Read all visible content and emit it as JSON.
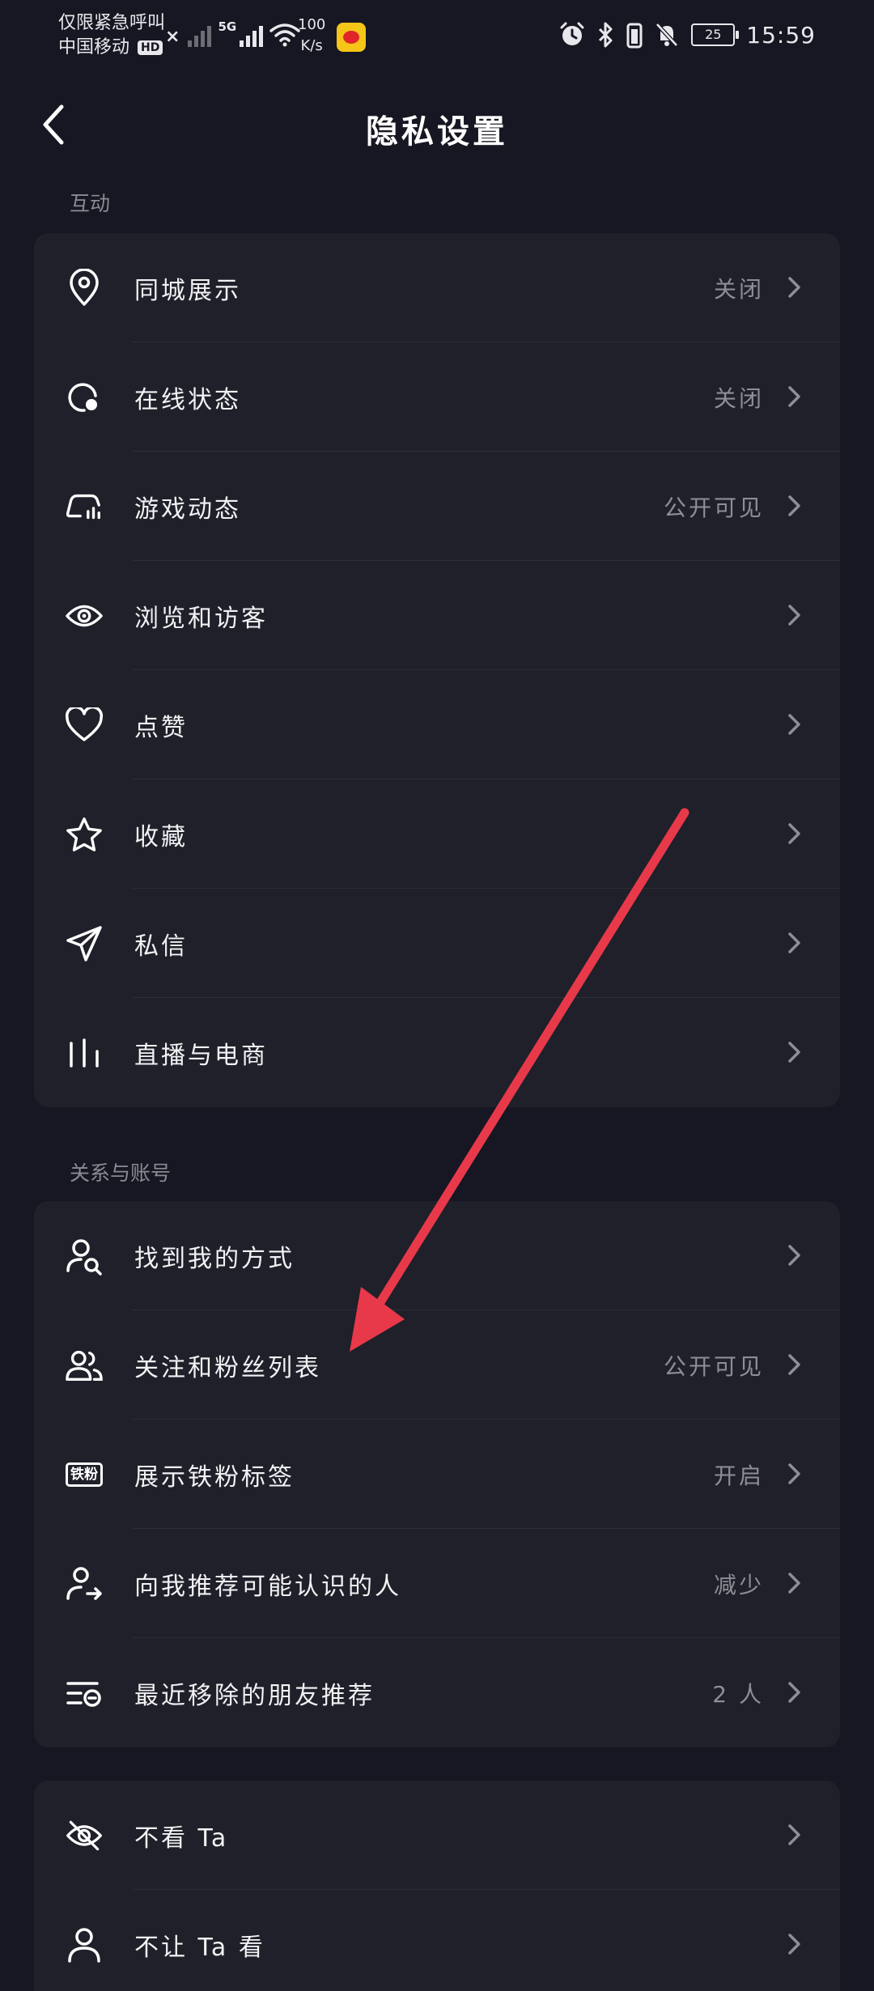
{
  "status_bar": {
    "line1": "仅限紧急呼叫",
    "line2": "中国移动",
    "hd": "HD",
    "x_mark": "×",
    "network": "5G",
    "speed_value": "100",
    "speed_unit": "K/s",
    "battery": "25",
    "time": "15:59"
  },
  "header": {
    "title": "隐私设置"
  },
  "sections": {
    "interaction": {
      "label": "互动",
      "items": [
        {
          "label": "同城展示",
          "value": "关闭",
          "icon": "location-pin-icon"
        },
        {
          "label": "在线状态",
          "value": "关闭",
          "icon": "online-status-icon"
        },
        {
          "label": "游戏动态",
          "value": "公开可见",
          "icon": "game-controller-icon"
        },
        {
          "label": "浏览和访客",
          "value": "",
          "icon": "eye-icon"
        },
        {
          "label": "点赞",
          "value": "",
          "icon": "heart-icon"
        },
        {
          "label": "收藏",
          "value": "",
          "icon": "star-icon"
        },
        {
          "label": "私信",
          "value": "",
          "icon": "paper-plane-icon"
        },
        {
          "label": "直播与电商",
          "value": "",
          "icon": "live-bars-icon"
        }
      ]
    },
    "relations": {
      "label": "关系与账号",
      "items": [
        {
          "label": "找到我的方式",
          "value": "",
          "icon": "find-person-icon"
        },
        {
          "label": "关注和粉丝列表",
          "value": "公开可见",
          "icon": "followers-icon"
        },
        {
          "label": "展示铁粉标签",
          "value": "开启",
          "icon": "fan-badge-icon",
          "badge": "铁粉"
        },
        {
          "label": "向我推荐可能认识的人",
          "value": "减少",
          "icon": "recommend-person-icon"
        },
        {
          "label": "最近移除的朋友推荐",
          "value": "2 人",
          "icon": "removed-list-icon"
        }
      ]
    },
    "more": {
      "items": [
        {
          "label": "不看 Ta",
          "value": "",
          "icon": "eye-off-icon"
        },
        {
          "label": "不让 Ta 看",
          "value": "",
          "icon": "person-icon"
        }
      ]
    }
  },
  "colors": {
    "background": "#161722",
    "card": "#1f2029",
    "text": "#f2f2f4",
    "secondary": "#8d8e96",
    "arrow": "#e8394a"
  }
}
